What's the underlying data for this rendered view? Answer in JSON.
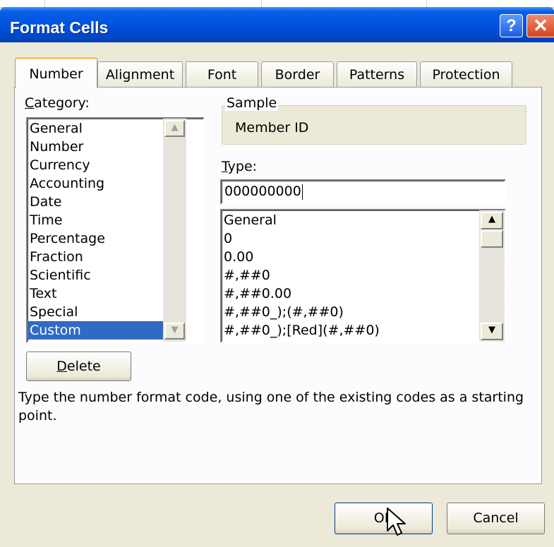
{
  "dialog": {
    "title": "Format Cells"
  },
  "titlebar": {
    "help_glyph": "?",
    "close_glyph": "✕"
  },
  "tabs": [
    {
      "label": "Number",
      "active": true
    },
    {
      "label": "Alignment",
      "active": false
    },
    {
      "label": "Font",
      "active": false
    },
    {
      "label": "Border",
      "active": false
    },
    {
      "label": "Patterns",
      "active": false
    },
    {
      "label": "Protection",
      "active": false
    }
  ],
  "category": {
    "label_accel": "C",
    "label_rest": "ategory:",
    "items": [
      "General",
      "Number",
      "Currency",
      "Accounting",
      "Date",
      "Time",
      "Percentage",
      "Fraction",
      "Scientific",
      "Text",
      "Special",
      "Custom"
    ],
    "selected": "Custom"
  },
  "sample": {
    "legend": "Sample",
    "value": "Member ID"
  },
  "type": {
    "label_accel": "T",
    "label_rest": "ype:",
    "value": "000000000",
    "list": [
      "General",
      "0",
      "0.00",
      "#,##0",
      "#,##0.00",
      "#,##0_);(#,##0)",
      "#,##0_);[Red](#,##0)"
    ]
  },
  "delete_button": {
    "label_accel": "D",
    "label_rest": "elete"
  },
  "description": "Type the number format code, using one of the existing codes as a starting point.",
  "footer": {
    "ok_label": "OK",
    "cancel_label": "Cancel"
  },
  "colors": {
    "title_bar": "#0054e3",
    "selection": "#316ac5",
    "dialog_bg": "#ece9d8",
    "close_button": "#d7441f"
  }
}
